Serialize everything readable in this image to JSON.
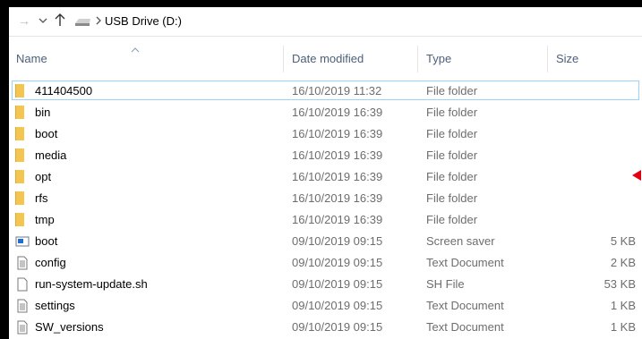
{
  "address": {
    "crumb": "USB Drive (D:)"
  },
  "columns": {
    "name": "Name",
    "date": "Date modified",
    "type": "Type",
    "size": "Size"
  },
  "colors": {
    "folder": "#f5c64f",
    "selection": "#99d1ff",
    "marker": "#e3000f"
  },
  "files": [
    {
      "name": "411404500",
      "date": "16/10/2019 11:32",
      "type": "File folder",
      "size": "",
      "icon": "folder-icon",
      "selected": true
    },
    {
      "name": "bin",
      "date": "16/10/2019 16:39",
      "type": "File folder",
      "size": "",
      "icon": "folder-icon"
    },
    {
      "name": "boot",
      "date": "16/10/2019 16:39",
      "type": "File folder",
      "size": "",
      "icon": "folder-icon"
    },
    {
      "name": "media",
      "date": "16/10/2019 16:39",
      "type": "File folder",
      "size": "",
      "icon": "folder-icon"
    },
    {
      "name": "opt",
      "date": "16/10/2019 16:39",
      "type": "File folder",
      "size": "",
      "icon": "folder-icon"
    },
    {
      "name": "rfs",
      "date": "16/10/2019 16:39",
      "type": "File folder",
      "size": "",
      "icon": "folder-icon"
    },
    {
      "name": "tmp",
      "date": "16/10/2019 16:39",
      "type": "File folder",
      "size": "",
      "icon": "folder-icon"
    },
    {
      "name": "boot",
      "date": "09/10/2019 09:15",
      "type": "Screen saver",
      "size": "5 KB",
      "icon": "screensaver-icon"
    },
    {
      "name": "config",
      "date": "09/10/2019 09:15",
      "type": "Text Document",
      "size": "2 KB",
      "icon": "text-document-icon"
    },
    {
      "name": "run-system-update.sh",
      "date": "09/10/2019 09:15",
      "type": "SH File",
      "size": "53 KB",
      "icon": "blank-file-icon"
    },
    {
      "name": "settings",
      "date": "09/10/2019 09:15",
      "type": "Text Document",
      "size": "1 KB",
      "icon": "text-document-icon"
    },
    {
      "name": "SW_versions",
      "date": "09/10/2019 09:15",
      "type": "Text Document",
      "size": "1 KB",
      "icon": "text-document-icon"
    }
  ]
}
